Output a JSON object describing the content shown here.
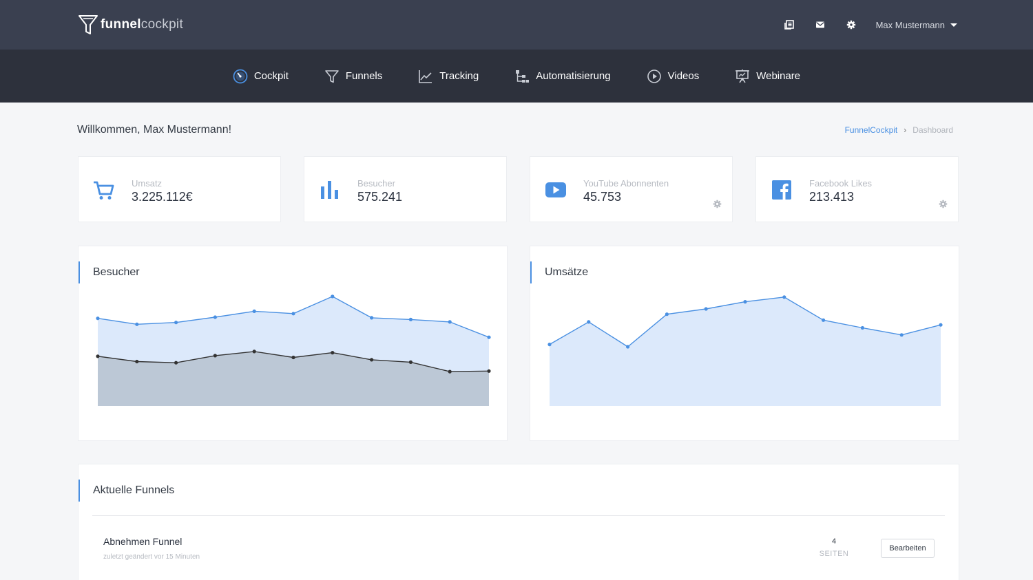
{
  "app": {
    "logo_bold": "funnel",
    "logo_light": "cockpit"
  },
  "topbar": {
    "icons": [
      "documents-icon",
      "mail-icon",
      "settings-icon"
    ],
    "user_name": "Max Mustermann"
  },
  "nav": {
    "items": [
      {
        "label": "Cockpit",
        "icon": "dashboard-icon",
        "active": true
      },
      {
        "label": "Funnels",
        "icon": "funnel-icon"
      },
      {
        "label": "Tracking",
        "icon": "line-chart-icon"
      },
      {
        "label": "Automatisierung",
        "icon": "hierarchy-icon"
      },
      {
        "label": "Videos",
        "icon": "play-circle-icon"
      },
      {
        "label": "Webinare",
        "icon": "presentation-icon"
      }
    ]
  },
  "header": {
    "welcome": "Willkommen, Max Mustermann!",
    "breadcrumb": {
      "link": "FunnelCockpit",
      "separator": "›",
      "current": "Dashboard"
    }
  },
  "stats": [
    {
      "label": "Umsatz",
      "value": "3.225.112€",
      "icon": "cart-icon",
      "settings": false
    },
    {
      "label": "Besucher",
      "value": "575.241",
      "icon": "bar-chart-icon",
      "settings": false
    },
    {
      "label": "YouTube Abonnenten",
      "value": "45.753",
      "icon": "youtube-icon",
      "settings": true
    },
    {
      "label": "Facebook Likes",
      "value": "213.413",
      "icon": "facebook-icon",
      "settings": true
    }
  ],
  "colors": {
    "accent": "#4a90e2",
    "topbar": "#3a4050",
    "navbar": "#2d313c",
    "area_light": "#dce9fb",
    "area_dark": "#bcc8d6",
    "line_dark": "#333333"
  },
  "panels": {
    "visitors_title": "Besucher",
    "revenue_title": "Umsätze",
    "funnels_title": "Aktuelle Funnels"
  },
  "chart_data": [
    {
      "type": "area",
      "title": "Besucher",
      "x": [
        1,
        2,
        3,
        4,
        5,
        6,
        7,
        8,
        9,
        10,
        11
      ],
      "ylim": [
        0,
        100
      ],
      "series": [
        {
          "values": [
            74,
            69,
            70.5,
            75,
            80,
            78,
            92.5,
            74.5,
            73,
            71,
            58
          ]
        },
        {
          "values": [
            42,
            37.5,
            36.5,
            42.5,
            46,
            41,
            45,
            39,
            37,
            29,
            29.5
          ]
        }
      ]
    },
    {
      "type": "area",
      "title": "Umsätze",
      "x": [
        1,
        2,
        3,
        4,
        5,
        6,
        7,
        8,
        9,
        10,
        11
      ],
      "ylim": [
        0,
        100
      ],
      "series": [
        {
          "values": [
            52,
            71,
            50,
            77.5,
            82,
            88,
            92,
            72.5,
            66,
            60,
            68.5
          ]
        }
      ]
    }
  ],
  "funnels": {
    "items": [
      {
        "name": "Abnehmen Funnel",
        "subtitle": "zuletzt geändert vor 15 Minuten",
        "pages": "4",
        "pages_label": "SEITEN",
        "action": "Bearbeiten"
      }
    ]
  }
}
